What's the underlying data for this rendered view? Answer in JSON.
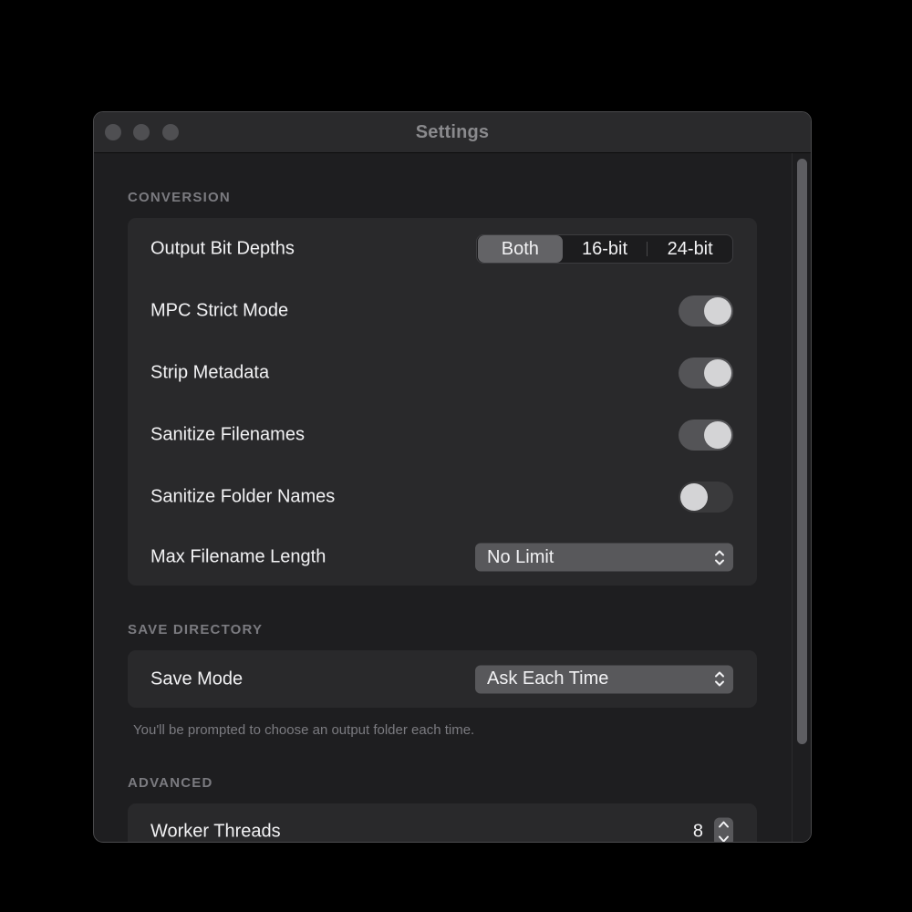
{
  "window": {
    "title": "Settings"
  },
  "conversion": {
    "header": "CONVERSION",
    "output_bit_depths": {
      "label": "Output Bit Depths",
      "options": [
        "Both",
        "16-bit",
        "24-bit"
      ],
      "selected": "Both"
    },
    "mpc_strict_mode": {
      "label": "MPC Strict Mode",
      "on": true
    },
    "strip_metadata": {
      "label": "Strip Metadata",
      "on": true
    },
    "sanitize_filenames": {
      "label": "Sanitize Filenames",
      "on": true
    },
    "sanitize_folder_names": {
      "label": "Sanitize Folder Names",
      "on": false
    },
    "max_filename_length": {
      "label": "Max Filename Length",
      "value": "No Limit"
    }
  },
  "save_directory": {
    "header": "SAVE DIRECTORY",
    "save_mode": {
      "label": "Save Mode",
      "value": "Ask Each Time"
    },
    "help": "You'll be prompted to choose an output folder each time."
  },
  "advanced": {
    "header": "ADVANCED",
    "worker_threads": {
      "label": "Worker Threads",
      "value": "8"
    }
  },
  "colors": {
    "window_bg": "#1e1e20",
    "card_bg": "#29292b",
    "toggle_on": "#545457",
    "toggle_off": "#3a3a3c",
    "selected_segment": "#636366"
  },
  "icons": {
    "popup_arrows": "chevron-up-down-icon",
    "stepper": "stepper-arrows-icon"
  }
}
